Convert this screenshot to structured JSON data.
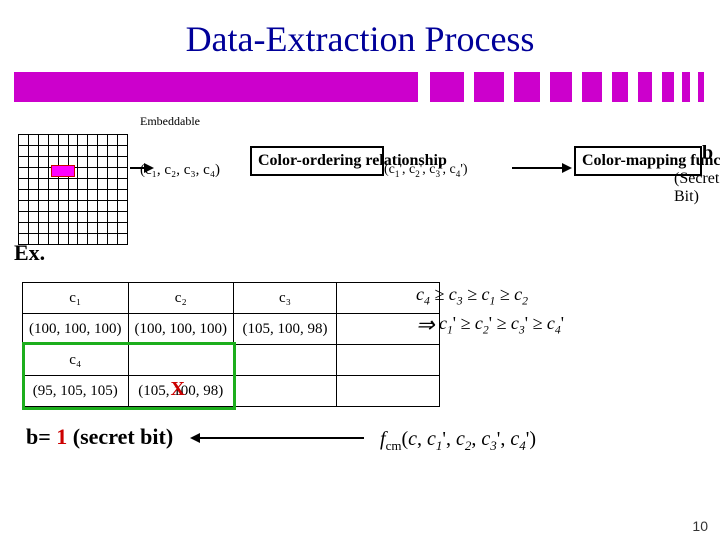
{
  "title": "Data-Extraction Process",
  "embed_label": "Embeddable",
  "input_tuple": "(c₁, c₂, c₃, c₄)",
  "order_box": "Color-ordering relationship",
  "sorted_tuple_html": "(c₁', c₂', c₃', c₄')",
  "map_box": "Color-mapping function",
  "b": "b",
  "secret_bit": "(Secret Bit)",
  "ex": "Ex.",
  "table": {
    "h": [
      "c₁",
      "c₂",
      "c₃"
    ],
    "r1": [
      "(100, 100, 100)",
      "(100, 100, 100)",
      "(105, 100, 98)"
    ],
    "h2": [
      "c₄",
      "",
      ""
    ],
    "r2": [
      "(95, 105, 105)",
      "(105, 100, 98)",
      ""
    ]
  },
  "crossed_out": "X",
  "formula_top": "c₄ ≥ c₃ ≥ c₁ ≥ c₂",
  "formula_bottom": "c₁' ≥ c₂' ≥ c₃' ≥ c₄'",
  "fcm": "f_cm(c, c₁', c₂, c₃', c₄')",
  "result_prefix": "b= ",
  "result_val": "1",
  "result_suffix": " (secret bit)",
  "slide_num": "10"
}
